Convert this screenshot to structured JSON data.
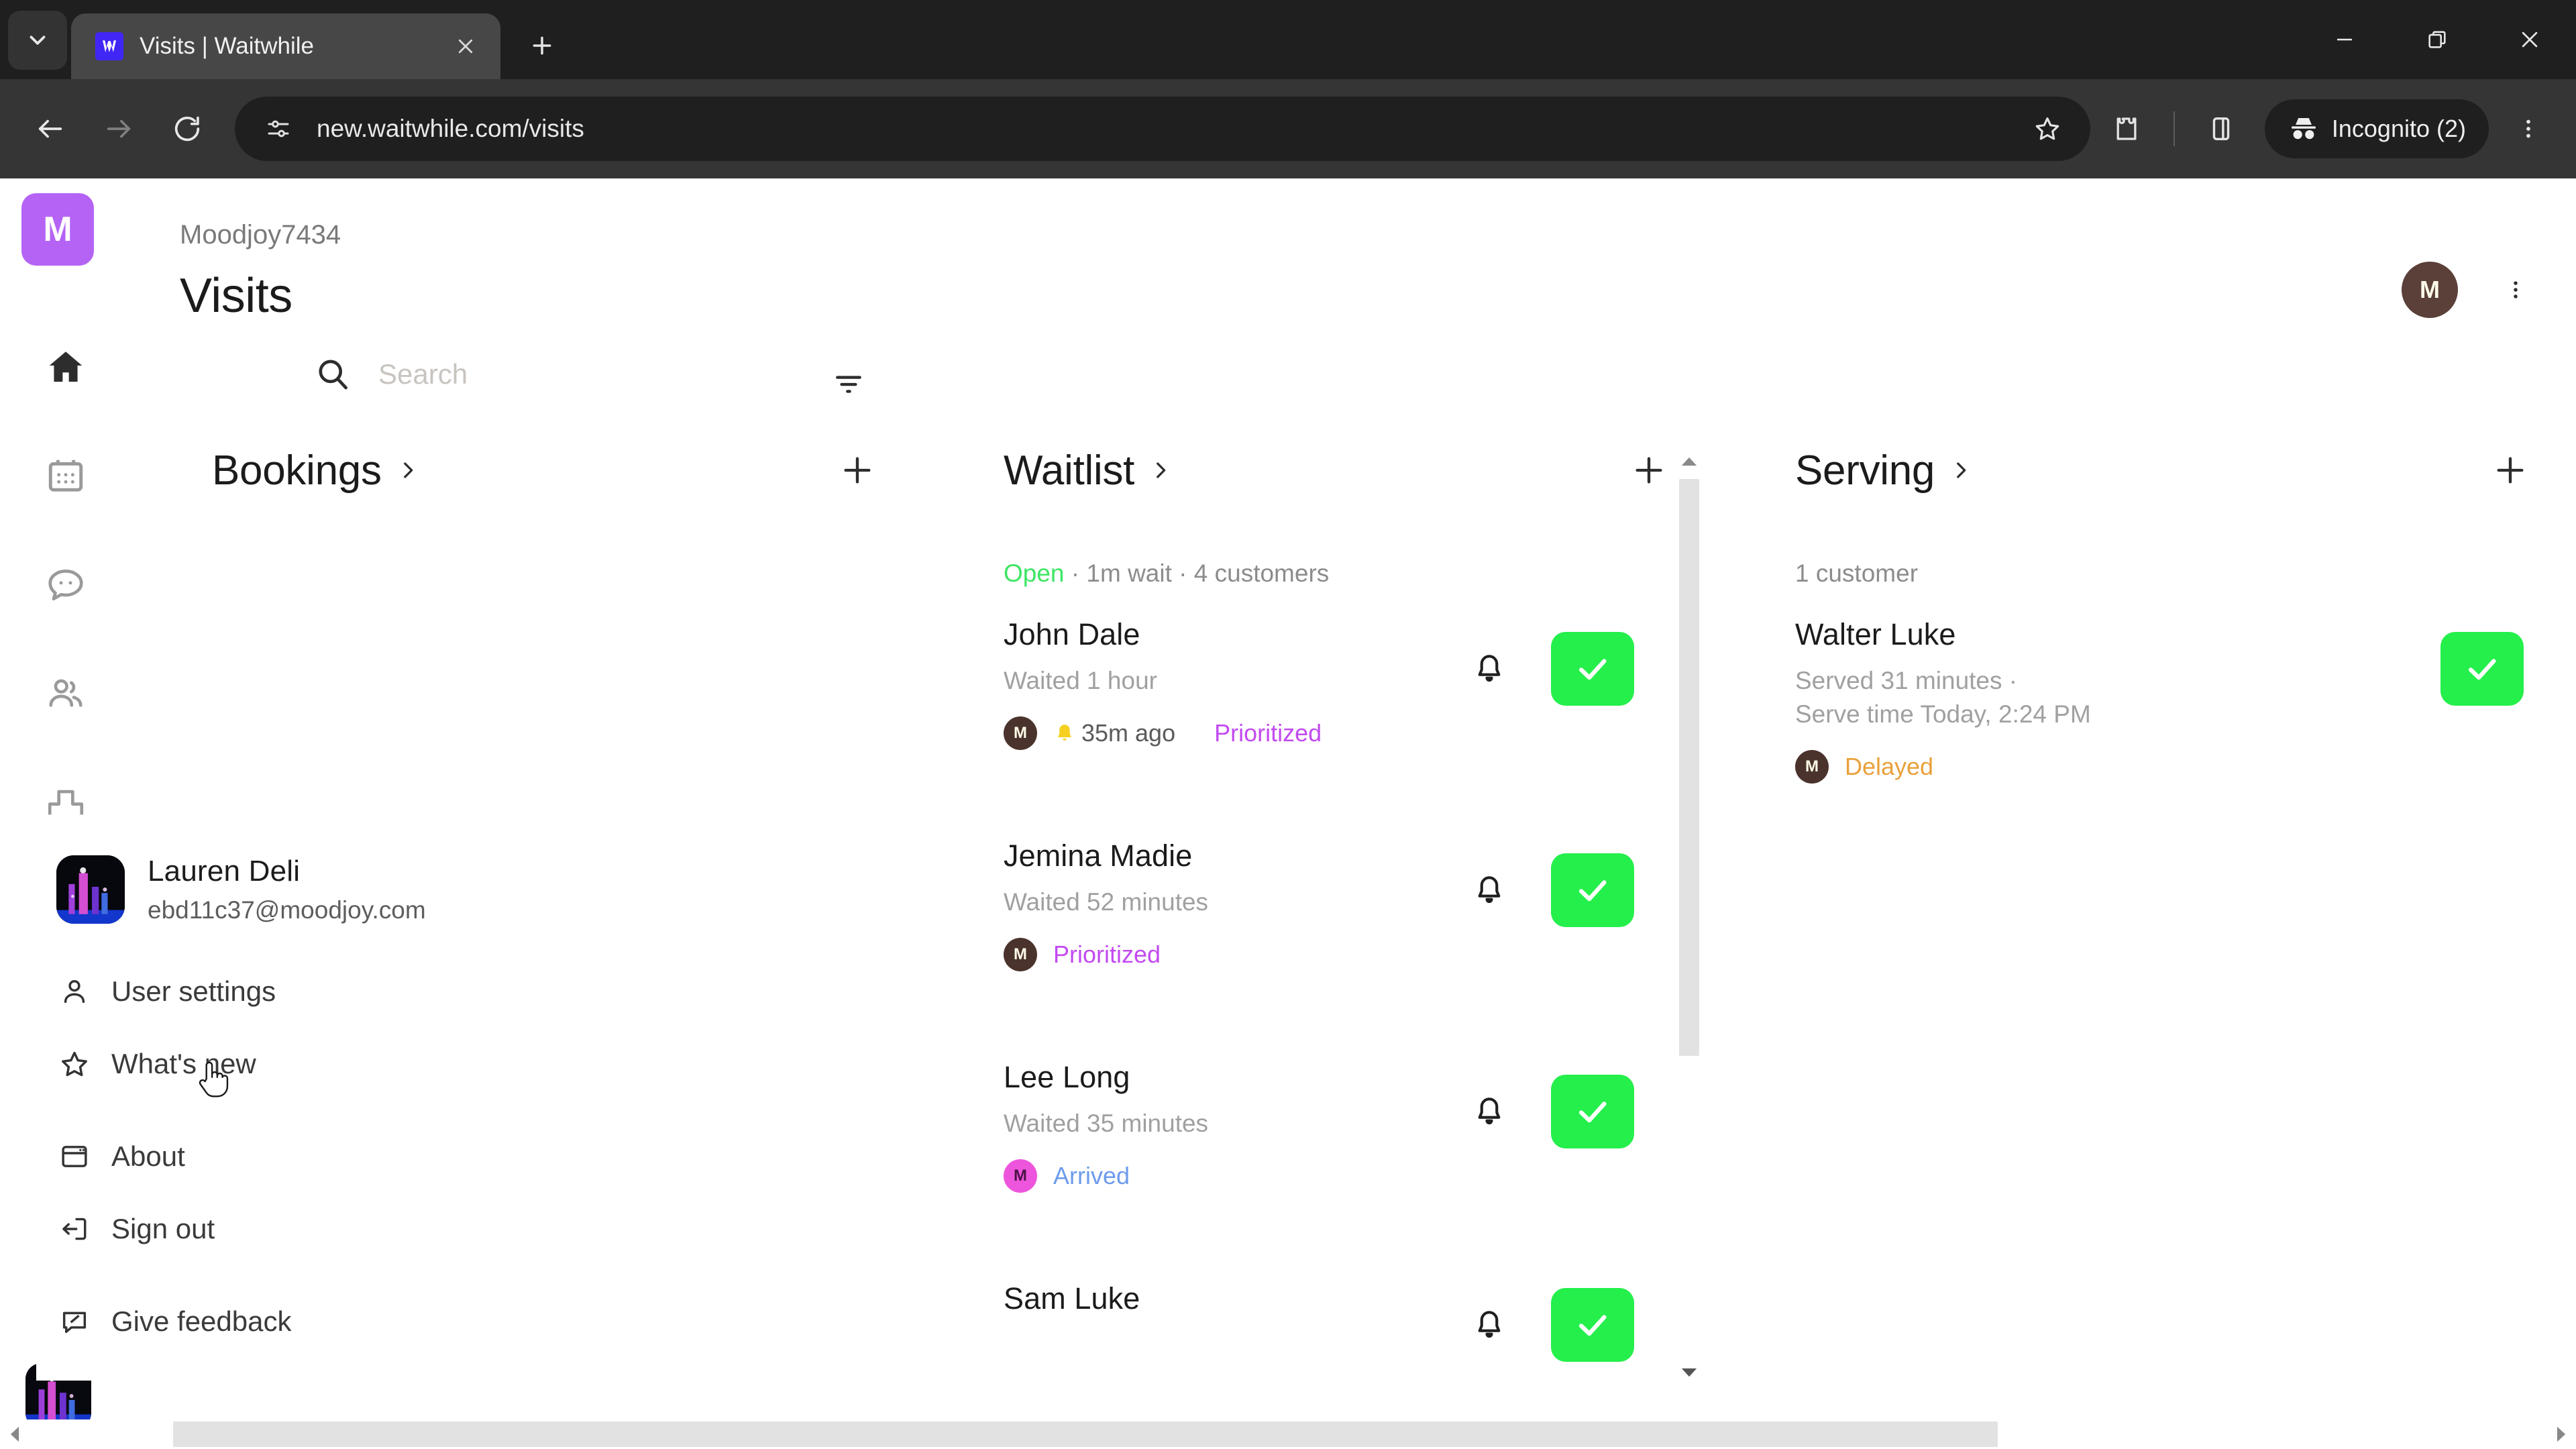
{
  "browser": {
    "tab": {
      "title": "Visits | Waitwhile",
      "favicon_icon": "waitwhile-logo-icon",
      "close_icon": "close-icon"
    },
    "tab_search_icon": "chevron-down-icon",
    "new_tab_icon": "plus-icon",
    "window": {
      "minimize_icon": "minimize-icon",
      "maximize_icon": "restore-icon",
      "close_icon": "close-icon"
    },
    "nav": {
      "back_icon": "arrow-left-icon",
      "forward_icon": "arrow-right-icon",
      "reload_icon": "reload-icon"
    },
    "omnibox": {
      "site_info_icon": "tune-icon",
      "url": "new.waitwhile.com/visits",
      "bookmark_icon": "star-icon",
      "extensions_icon": "puzzle-icon",
      "sidepanel_icon": "side-panel-icon"
    },
    "incognito": {
      "icon": "incognito-icon",
      "label": "Incognito (2)"
    },
    "chrome_menu_icon": "kebab-menu-icon"
  },
  "app": {
    "rail": {
      "logo_initial": "M",
      "items": [
        {
          "name": "home",
          "icon": "home-icon",
          "active": true
        },
        {
          "name": "calendar",
          "icon": "calendar-icon",
          "active": false
        },
        {
          "name": "messages",
          "icon": "chat-bubble-icon",
          "active": false
        },
        {
          "name": "customers",
          "icon": "people-icon",
          "active": false
        },
        {
          "name": "analytics",
          "icon": "bar-chart-icon",
          "active": false
        }
      ],
      "avatar_icon": "account-avatar-icon"
    },
    "header": {
      "org_name": "Moodjoy7434",
      "page_title": "Visits",
      "avatar_initial": "M",
      "kebab_icon": "kebab-menu-icon"
    },
    "search": {
      "icon": "search-icon",
      "placeholder": "Search",
      "value": "",
      "filter_icon": "filter-icon"
    },
    "user_menu": {
      "profile": {
        "name": "Lauren Deli",
        "email": "ebd11c37@moodjoy.com",
        "avatar_icon": "profile-photo-icon"
      },
      "items": [
        {
          "label": "User settings",
          "icon": "person-icon"
        },
        {
          "label": "What's new",
          "icon": "star-icon"
        },
        {
          "label": "About",
          "icon": "window-icon"
        },
        {
          "label": "Sign out",
          "icon": "sign-out-icon"
        },
        {
          "label": "Give feedback",
          "icon": "feedback-icon"
        }
      ]
    },
    "columns": [
      {
        "id": "bookings",
        "title": "Bookings",
        "chevron_icon": "chevron-right-icon",
        "add_icon": "plus-icon",
        "meta": "",
        "meta_status": "",
        "cards": []
      },
      {
        "id": "waitlist",
        "title": "Waitlist",
        "chevron_icon": "chevron-right-icon",
        "add_icon": "plus-icon",
        "meta_status": "Open",
        "meta": " · 1m wait · 4 customers",
        "cards": [
          {
            "name": "John Dale",
            "sub": "Waited 1 hour",
            "avatar_initial": "M",
            "avatar_color": "brown",
            "notify_icon": "bell-yellow-icon",
            "time": "35m ago",
            "status": "Prioritized",
            "status_kind": "prioritized",
            "bell_icon": "bell-icon",
            "serve_icon": "check-icon"
          },
          {
            "name": "Jemina Madie",
            "sub": "Waited 52 minutes",
            "avatar_initial": "M",
            "avatar_color": "brown",
            "time": "",
            "status": "Prioritized",
            "status_kind": "prioritized",
            "bell_icon": "bell-icon",
            "serve_icon": "check-icon"
          },
          {
            "name": "Lee Long",
            "sub": "Waited 35 minutes",
            "avatar_initial": "M",
            "avatar_color": "pink",
            "time": "",
            "status": "Arrived",
            "status_kind": "arrived",
            "bell_icon": "bell-icon",
            "serve_icon": "check-icon"
          },
          {
            "name": "Sam Luke",
            "sub": "",
            "status": "",
            "status_kind": "",
            "bell_icon": "bell-icon",
            "serve_icon": "check-icon"
          }
        ]
      },
      {
        "id": "serving",
        "title": "Serving",
        "chevron_icon": "chevron-right-icon",
        "add_icon": "plus-icon",
        "meta_status": "",
        "meta": "1 customer",
        "cards": [
          {
            "name": "Walter Luke",
            "sub": "Served 31 minutes ·\nServe time Today, 2:24 PM",
            "avatar_initial": "M",
            "avatar_color": "brown",
            "status": "Delayed",
            "status_kind": "delayed",
            "serve_icon": "check-icon"
          }
        ]
      }
    ],
    "scrollbars": {
      "vertical_up_icon": "triangle-up-icon",
      "vertical_down_icon": "triangle-down-icon",
      "horizontal_left_icon": "triangle-left-icon",
      "horizontal_right_icon": "triangle-right-icon"
    }
  },
  "colors": {
    "brand_purple": "#b563f5",
    "serve_green": "#24ef4b",
    "open_green": "#3ee564",
    "prioritized_purple": "#c24af0",
    "arrived_blue": "#6d9bec",
    "delayed_orange": "#e9a13b",
    "avatar_brown": "#4a332c",
    "avatar_pink": "#ee55dd",
    "favicon_blue": "#4127f5"
  }
}
